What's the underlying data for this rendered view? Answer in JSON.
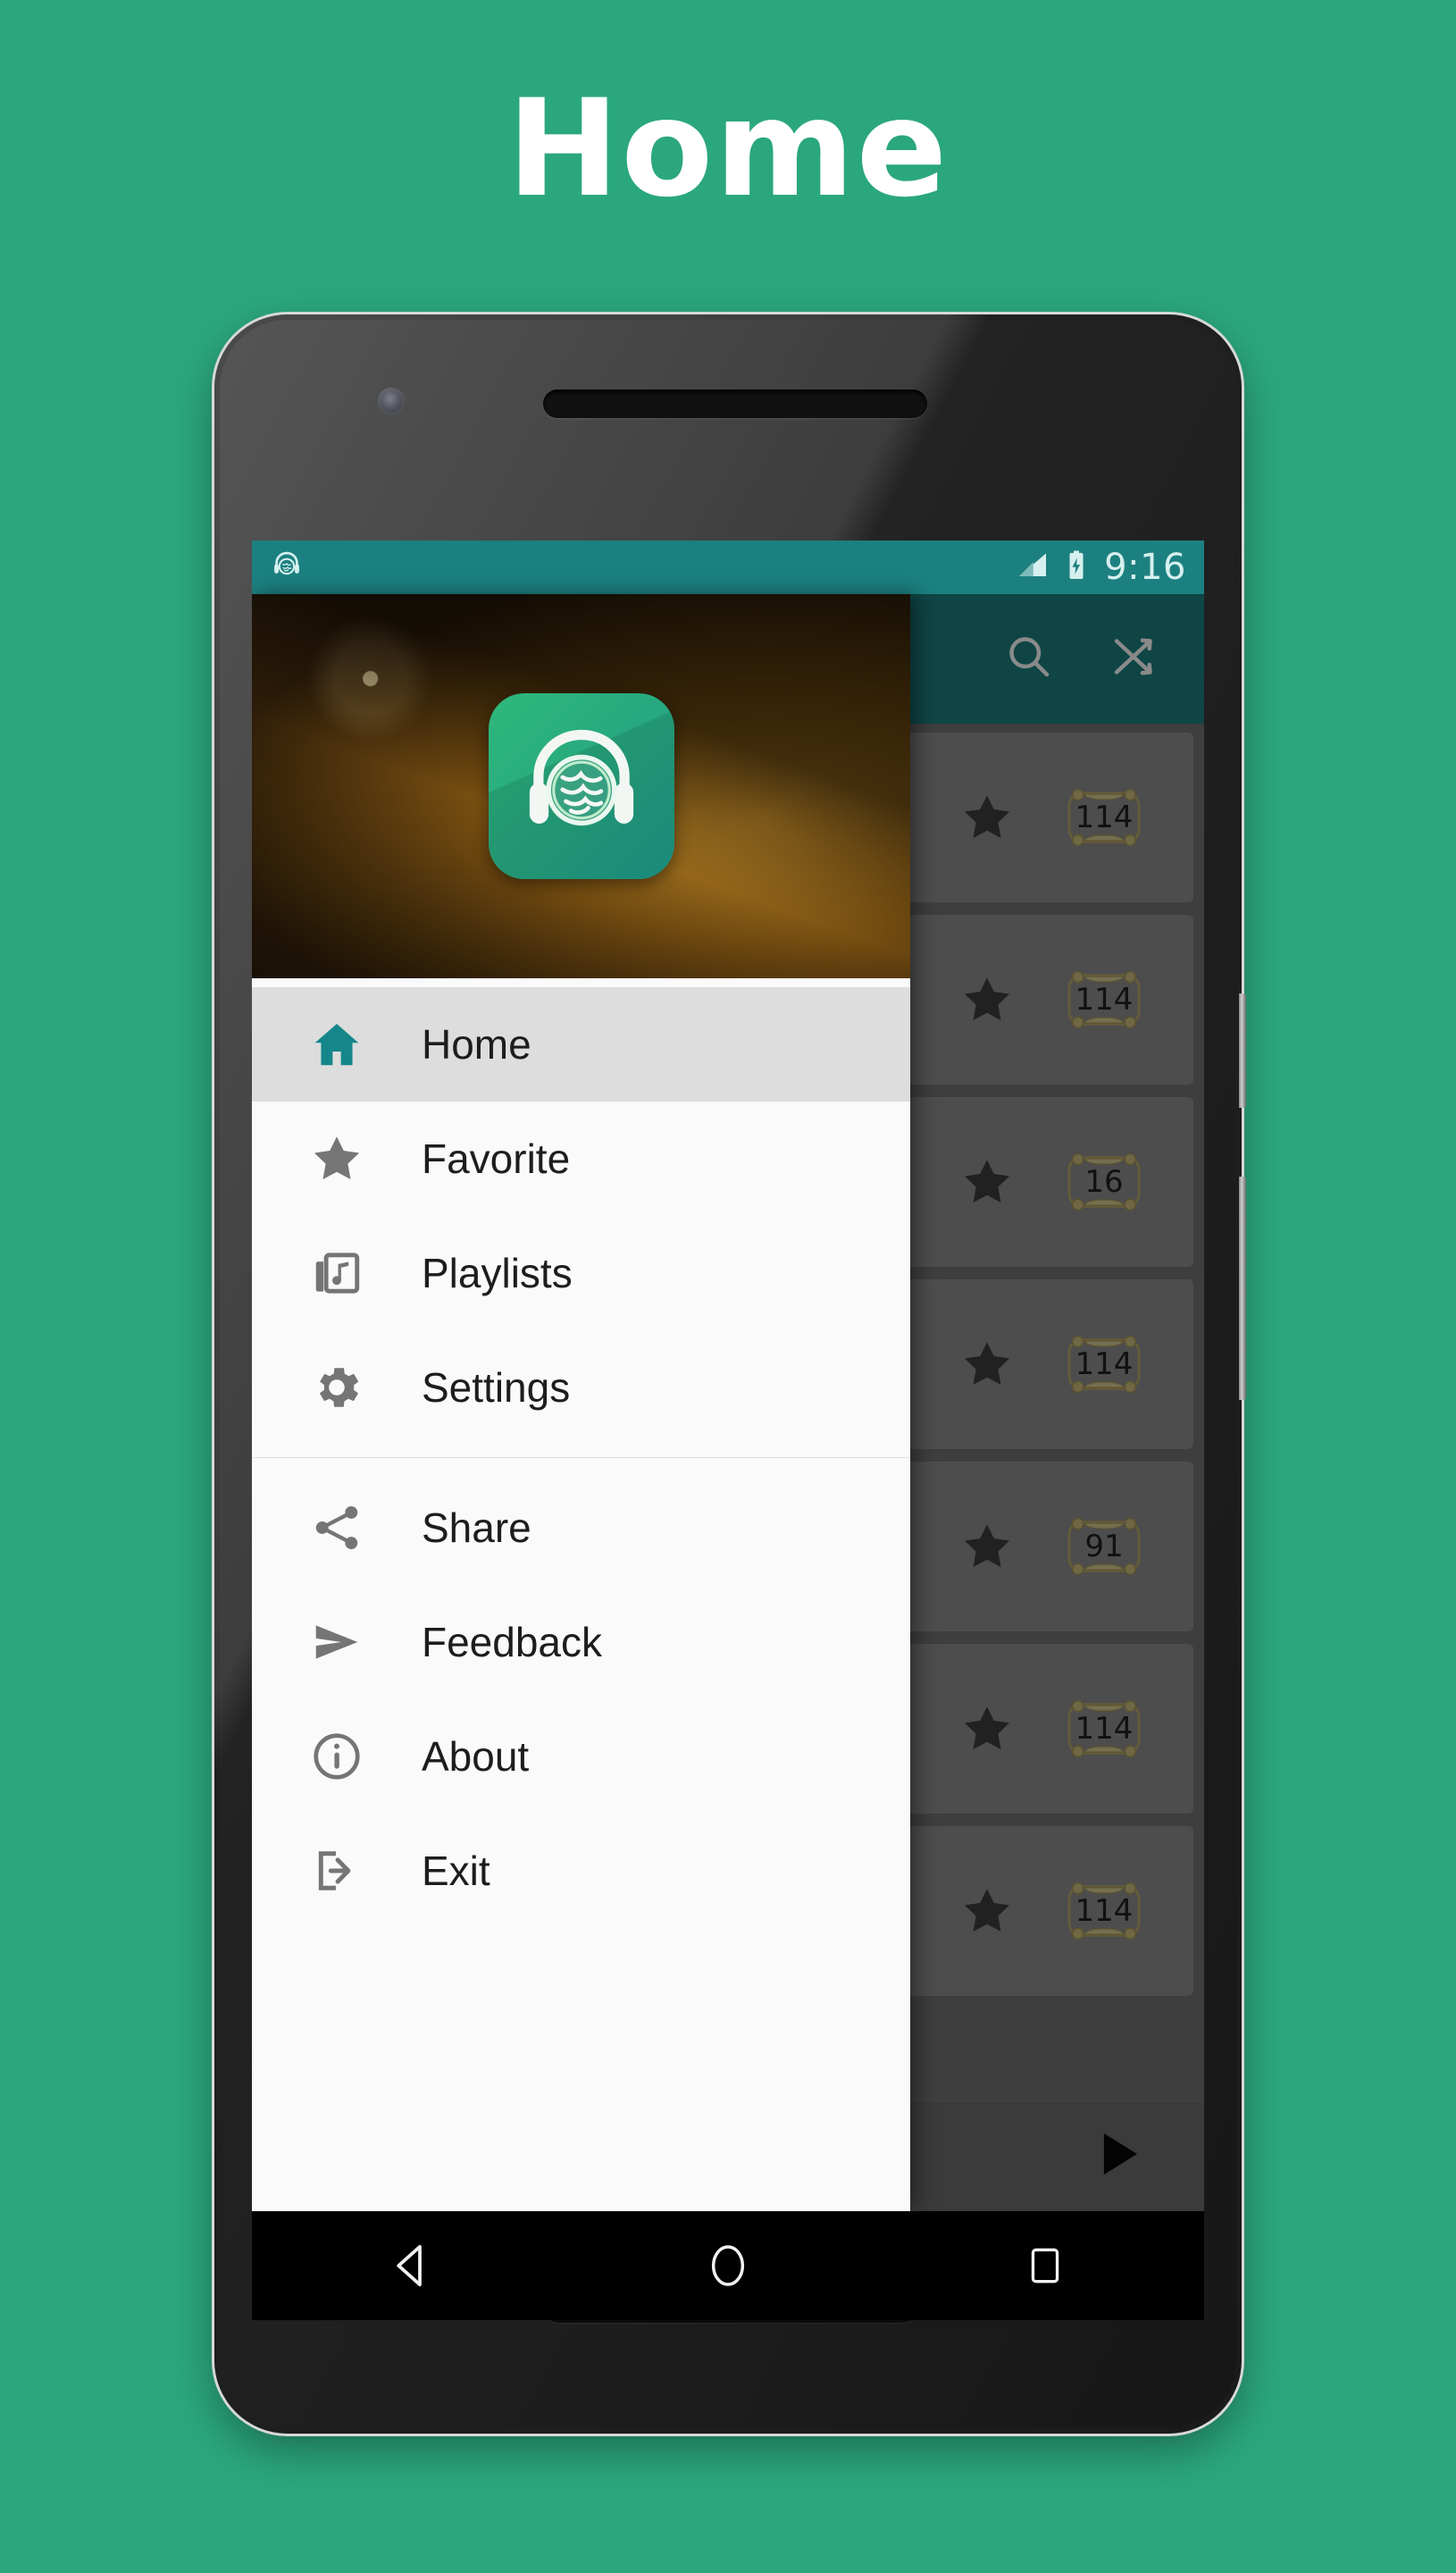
{
  "page": {
    "title": "Home",
    "background_color": "#2BA77D"
  },
  "status_bar": {
    "notification_icon": "quran-headphones-notification-icon",
    "signal_icon": "signal-bars-icon",
    "battery_icon": "battery-charging-icon",
    "clock": "9:16",
    "background_color": "#1D8080"
  },
  "toolbar": {
    "search_icon": "search-icon",
    "shuffle_icon": "shuffle-icon",
    "background_color": "#1D8080"
  },
  "drawer": {
    "header": {
      "logo_icon": "quran-audio-app-logo",
      "background_image": "quran-book-photo"
    },
    "groups": [
      {
        "items": [
          {
            "label": "Home",
            "icon": "home-icon",
            "active": true,
            "icon_color": "#15878A"
          },
          {
            "label": "Favorite",
            "icon": "star-icon",
            "active": false,
            "icon_color": "#757575"
          },
          {
            "label": "Playlists",
            "icon": "playlist-icon",
            "active": false,
            "icon_color": "#757575"
          },
          {
            "label": "Settings",
            "icon": "gear-icon",
            "active": false,
            "icon_color": "#757575"
          }
        ]
      },
      {
        "items": [
          {
            "label": "Share",
            "icon": "share-icon",
            "active": false,
            "icon_color": "#757575"
          },
          {
            "label": "Feedback",
            "icon": "send-icon",
            "active": false,
            "icon_color": "#757575"
          },
          {
            "label": "About",
            "icon": "info-icon",
            "active": false,
            "icon_color": "#757575"
          },
          {
            "label": "Exit",
            "icon": "exit-icon",
            "active": false,
            "icon_color": "#757575"
          }
        ]
      }
    ]
  },
  "surah_list": {
    "items": [
      {
        "star_icon": "star-icon",
        "ayah_count": "114"
      },
      {
        "star_icon": "star-icon",
        "ayah_count": "114"
      },
      {
        "star_icon": "star-icon",
        "ayah_count": "16"
      },
      {
        "star_icon": "star-icon",
        "ayah_count": "114"
      },
      {
        "star_icon": "star-icon",
        "ayah_count": "91"
      },
      {
        "star_icon": "star-icon",
        "ayah_count": "114"
      },
      {
        "star_icon": "star-icon",
        "ayah_count": "114"
      }
    ]
  },
  "mini_player": {
    "play_icon": "play-icon"
  },
  "nav_bar": {
    "back_icon": "back-triangle-icon",
    "home_icon": "home-circle-icon",
    "recents_icon": "recents-square-icon"
  }
}
